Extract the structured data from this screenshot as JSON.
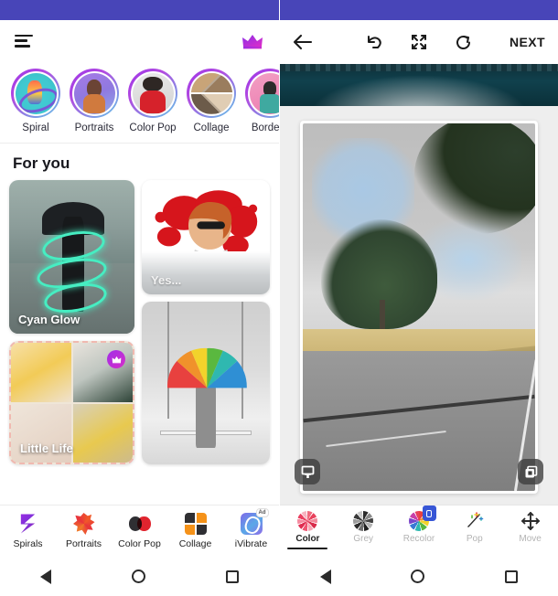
{
  "left_screen": {
    "status_bar": {
      "color": "#4845b8"
    },
    "header": {
      "menu_icon": "hamburger-menu-icon",
      "premium_icon": "crown-icon"
    },
    "categories": [
      {
        "label": "Spiral",
        "icon": "spiral-thumb"
      },
      {
        "label": "Portraits",
        "icon": "portraits-thumb"
      },
      {
        "label": "Color Pop",
        "icon": "color-pop-thumb"
      },
      {
        "label": "Collage",
        "icon": "collage-thumb"
      },
      {
        "label": "Borders",
        "icon": "borders-thumb"
      }
    ],
    "for_you": {
      "title": "For you",
      "cards": [
        {
          "label": "Cyan Glow",
          "premium": false
        },
        {
          "label": "Yes...",
          "premium": false
        },
        {
          "label": "Little Life",
          "premium": true
        },
        {
          "label": "",
          "premium": false
        }
      ]
    },
    "bottom_nav": [
      {
        "label": "Spirals",
        "icon": "spirals-icon",
        "ad": false
      },
      {
        "label": "Portraits",
        "icon": "portraits-icon",
        "ad": false
      },
      {
        "label": "Color Pop",
        "icon": "color-pop-icon",
        "ad": false
      },
      {
        "label": "Collage",
        "icon": "collage-icon",
        "ad": false
      },
      {
        "label": "iVibrate",
        "icon": "ivibrate-icon",
        "ad": true,
        "ad_label": "Ad"
      }
    ]
  },
  "right_screen": {
    "status_bar": {
      "color": "#4845b8"
    },
    "toolbar": {
      "back_icon": "back-arrow-icon",
      "undo_icon": "undo-icon",
      "fullscreen_icon": "fullscreen-icon",
      "rotate_icon": "rotate-refresh-icon",
      "next_label": "NEXT"
    },
    "canvas": {
      "brush_icon": "brush-tool-icon",
      "layers_icon": "layers-compare-icon"
    },
    "filters": [
      {
        "label": "Color",
        "icon": "color-wheel-icon",
        "active": true
      },
      {
        "label": "Grey",
        "icon": "grey-wheel-icon",
        "active": false
      },
      {
        "label": "Recolor",
        "icon": "recolor-wheel-icon",
        "active": false
      },
      {
        "label": "Pop",
        "icon": "magic-wand-icon",
        "active": false
      },
      {
        "label": "Move",
        "icon": "move-arrows-icon",
        "active": false
      }
    ]
  },
  "system_nav": {
    "back_icon": "system-back-icon",
    "home_icon": "system-home-icon",
    "recents_icon": "system-recents-icon"
  }
}
